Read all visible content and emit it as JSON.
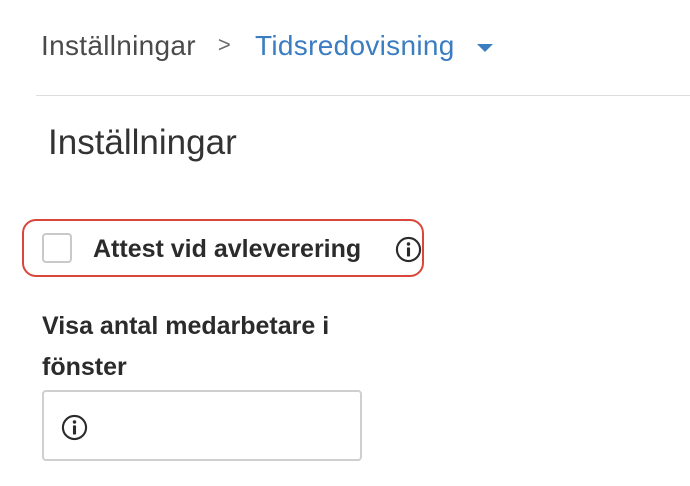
{
  "breadcrumb": {
    "root": "Inställningar",
    "separator": ">",
    "current": "Tidsredovisning",
    "current_icon": "caret-down-icon"
  },
  "page_title": "Inställningar",
  "attest_option": {
    "label": "Attest vid avleverering",
    "checked": false,
    "info_icon": "info-icon",
    "highlight_color": "#d9473b"
  },
  "employees_field": {
    "label": "Visa antal medarbetare i fönster",
    "value": "",
    "placeholder": "",
    "info_icon": "info-icon"
  },
  "colors": {
    "link": "#3a7dc0",
    "text": "#2b2b2b",
    "highlight": "#d9473b"
  }
}
